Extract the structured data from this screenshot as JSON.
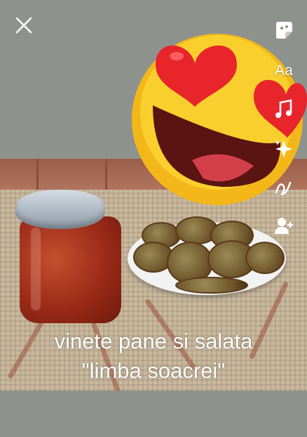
{
  "story_editor": {
    "toolbar": {
      "close_icon": "close-icon",
      "sticker_icon": "sticker-icon",
      "text_label": "Aa",
      "music_icon": "music-note-icon",
      "effects_icon": "sparkle-icon",
      "draw_icon": "scribble-icon",
      "tag_icon": "tag-person-icon"
    },
    "caption": {
      "line1": "vinete pane si salata",
      "line2": "\"limba soacrei\""
    },
    "sticker": {
      "name": "heart-eyes-emoji",
      "face_color": "#f7c324",
      "heart_color": "#e8252b"
    },
    "colors": {
      "background": "#8e928c",
      "icon": "#ffffff"
    }
  }
}
